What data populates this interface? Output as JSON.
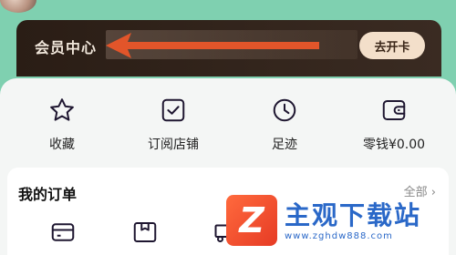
{
  "member": {
    "label": "会员中心",
    "open_card": "去开卡"
  },
  "shortcuts": [
    {
      "label": "收藏",
      "icon": "star-icon"
    },
    {
      "label": "订阅店铺",
      "icon": "check-square-icon"
    },
    {
      "label": "足迹",
      "icon": "clock-icon"
    },
    {
      "label": "零钱¥0.00",
      "icon": "wallet-icon"
    }
  ],
  "orders": {
    "title": "我的订单",
    "all_link": "全部 ›",
    "icons": [
      "card-icon",
      "package-icon",
      "truck-icon"
    ]
  },
  "watermark": {
    "name": "主观下载站",
    "url": "www.zghdw888.com"
  },
  "colors": {
    "background": "#7fd0b0",
    "member_bar": "#2a1d15",
    "arrow": "#e2552a",
    "open_card_bg": "#f3dfca",
    "icon_stroke": "#1e1630"
  }
}
